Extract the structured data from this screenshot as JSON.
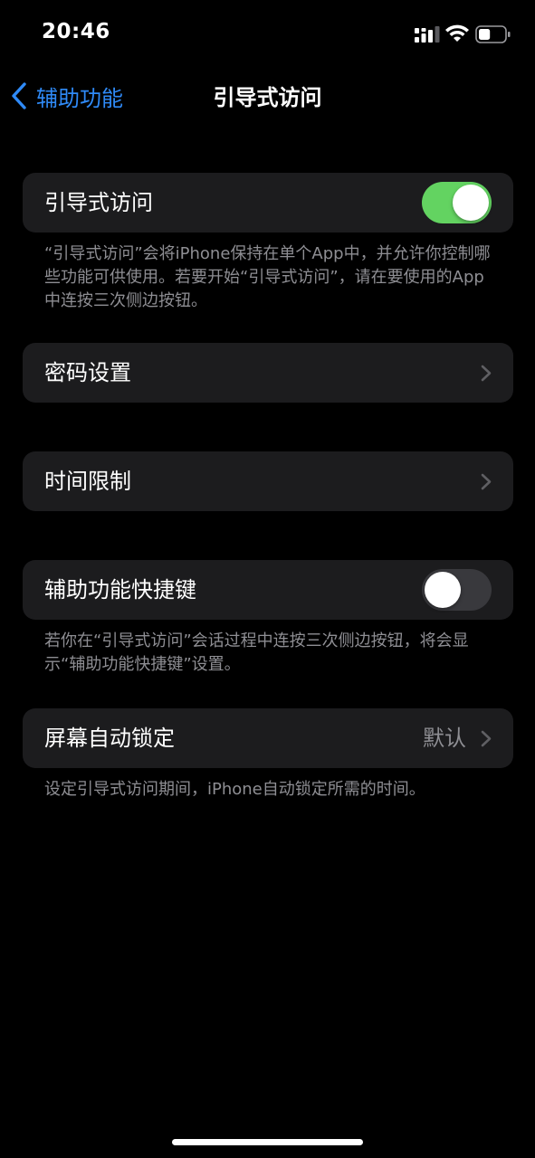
{
  "status_bar": {
    "time": "20:46",
    "signal_icon": "cellular-signal-icon",
    "wifi_icon": "wifi-icon",
    "battery_icon": "battery-icon",
    "battery_level": 0.45
  },
  "nav": {
    "back_label": "辅助功能",
    "title": "引导式访问"
  },
  "groups": {
    "guided_access": {
      "label": "引导式访问",
      "toggle_on": true,
      "footnote": "“引导式访问”会将iPhone保持在单个App中，并允许你控制哪些功能可供使用。若要开始“引导式访问”，请在要使用的App中连按三次侧边按钮。"
    },
    "passcode": {
      "label": "密码设置"
    },
    "time_limits": {
      "label": "时间限制"
    },
    "accessibility_shortcut": {
      "label": "辅助功能快捷键",
      "toggle_on": false,
      "footnote": "若你在“引导式访问”会话过程中连按三次侧边按钮，将会显示“辅助功能快捷键”设置。"
    },
    "auto_lock": {
      "label": "屏幕自动锁定",
      "value": "默认",
      "footnote": "设定引导式访问期间，iPhone自动锁定所需的时间。"
    }
  },
  "colors": {
    "accent": "#2f8af7",
    "toggle_on": "#63d361",
    "toggle_off": "#39393d",
    "cell_bg": "#1c1c1e",
    "secondary_text": "#8e8e93"
  }
}
